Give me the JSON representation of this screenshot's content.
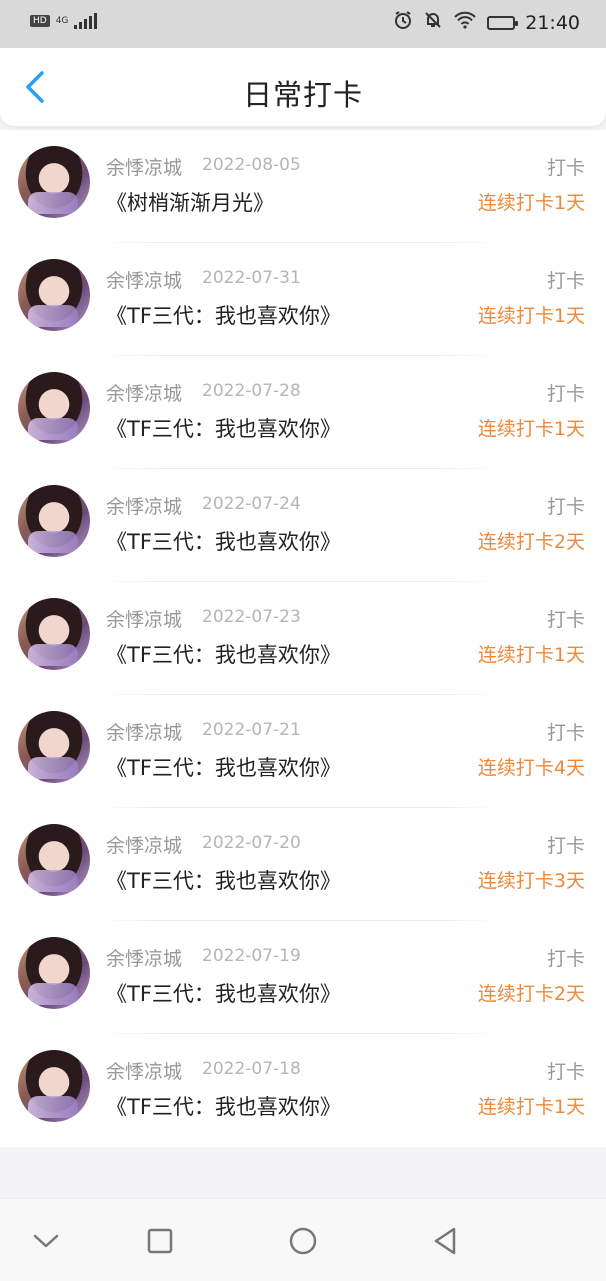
{
  "status_bar": {
    "hd": "HD",
    "network": "4G",
    "time": "21:40",
    "battery_color": "#32c832"
  },
  "header": {
    "title": "日常打卡",
    "back_icon": "chevron-left-icon",
    "accent_color": "#2a9df4"
  },
  "list": {
    "items": [
      {
        "user": "余悸凉城",
        "date": "2022-08-05",
        "content": "《树梢渐渐月光》",
        "kind": "打卡",
        "streak": "连续打卡1天"
      },
      {
        "user": "余悸凉城",
        "date": "2022-07-31",
        "content": "《TF三代：我也喜欢你》",
        "kind": "打卡",
        "streak": "连续打卡1天"
      },
      {
        "user": "余悸凉城",
        "date": "2022-07-28",
        "content": "《TF三代：我也喜欢你》",
        "kind": "打卡",
        "streak": "连续打卡1天"
      },
      {
        "user": "余悸凉城",
        "date": "2022-07-24",
        "content": "《TF三代：我也喜欢你》",
        "kind": "打卡",
        "streak": "连续打卡2天"
      },
      {
        "user": "余悸凉城",
        "date": "2022-07-23",
        "content": "《TF三代：我也喜欢你》",
        "kind": "打卡",
        "streak": "连续打卡1天"
      },
      {
        "user": "余悸凉城",
        "date": "2022-07-21",
        "content": "《TF三代：我也喜欢你》",
        "kind": "打卡",
        "streak": "连续打卡4天"
      },
      {
        "user": "余悸凉城",
        "date": "2022-07-20",
        "content": "《TF三代：我也喜欢你》",
        "kind": "打卡",
        "streak": "连续打卡3天"
      },
      {
        "user": "余悸凉城",
        "date": "2022-07-19",
        "content": "《TF三代：我也喜欢你》",
        "kind": "打卡",
        "streak": "连续打卡2天"
      },
      {
        "user": "余悸凉城",
        "date": "2022-07-18",
        "content": "《TF三代：我也喜欢你》",
        "kind": "打卡",
        "streak": "连续打卡1天"
      }
    ],
    "streak_color": "#f0883a"
  },
  "nav_bar": {
    "icons": [
      "chevron-down-icon",
      "square-recents-icon",
      "circle-home-icon",
      "triangle-back-icon"
    ]
  }
}
